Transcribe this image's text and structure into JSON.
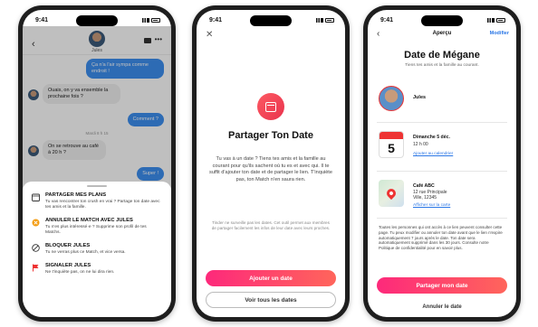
{
  "status": {
    "time": "9:41"
  },
  "phone1": {
    "contact": "Jules",
    "messages": [
      {
        "dir": "out",
        "text": "Ça n'a l'air sympa comme endroit !"
      },
      {
        "dir": "in",
        "text": "Ouais, on y va ensemble la prochaine fois ?"
      },
      {
        "dir": "out",
        "text": "Comment ?"
      },
      {
        "dir": "in",
        "text": "On se retrouve au café à 20 h ?"
      },
      {
        "dir": "out",
        "text": "Super !"
      }
    ],
    "timestamp": "Mardi 8 h 15",
    "sheet": [
      {
        "icon": "calendar-icon",
        "title": "PARTAGER MES PLANS",
        "desc": "Tu vas rencontrer ton crush en vrai ? Partage ton date avec tes amis et la famille."
      },
      {
        "icon": "match-icon",
        "title": "ANNULER LE MATCH AVEC JULES",
        "desc": "Tu n'es plus intéressé·e ? Supprime son profil de tes Matchs."
      },
      {
        "icon": "block-icon",
        "title": "BLOQUER JULES",
        "desc": "Tu ne verras plus ce Match, et vice versa."
      },
      {
        "icon": "flag-icon",
        "title": "SIGNALER JULES",
        "desc": "Ne t'inquiète pas, on ne lui dira rien."
      }
    ]
  },
  "phone2": {
    "close": "✕",
    "title": "Partager Ton Date",
    "body": "Tu vas à un date ? Tiens tes amis et la famille au courant pour qu'ils sachent où tu es et avec qui. Il te suffit d'ajouter ton date et de partager le lien. T'inquiète pas, ton Match n'en saura rien.",
    "note": "Tinder ne surveille pas les dates. Cet outil permet aux membres de partager facilement les infos de leur date avec leurs proches.",
    "primary_button": "Ajouter un date",
    "secondary_button": "Voir tous les dates"
  },
  "phone3": {
    "header_title": "Aperçu",
    "edit": "Modifier",
    "title": "Date de Mégane",
    "subtitle": "Tiens tes amis et la famille au courant.",
    "match_name": "Jules",
    "day_number": "5",
    "event_date": "Dimanche 5 déc.",
    "event_time": "12 h 00",
    "calendar_link": "Ajouter au calendrier",
    "place_name": "Café ABC",
    "place_street": "12 rue Principale",
    "place_city": "Ville, 12345",
    "map_link": "Afficher sur la carte",
    "note": "Toutes les personnes qui ont accès à ce lien peuvent consulter cette page. Tu peux modifier ou annuler ton date avant que le lien n'expire automatiquement 7 jours après le date. Ton date sera automatiquement supprimé dans les 30 jours. Consulte notre Politique de confidentialité pour en savoir plus.",
    "primary_button": "Partager mon date",
    "cancel_link": "Annuler le date"
  },
  "colors": {
    "accent_start": "#fd297b",
    "accent_end": "#ff655b",
    "link": "#2b77e6",
    "bubble_out": "#3d8ff0"
  }
}
